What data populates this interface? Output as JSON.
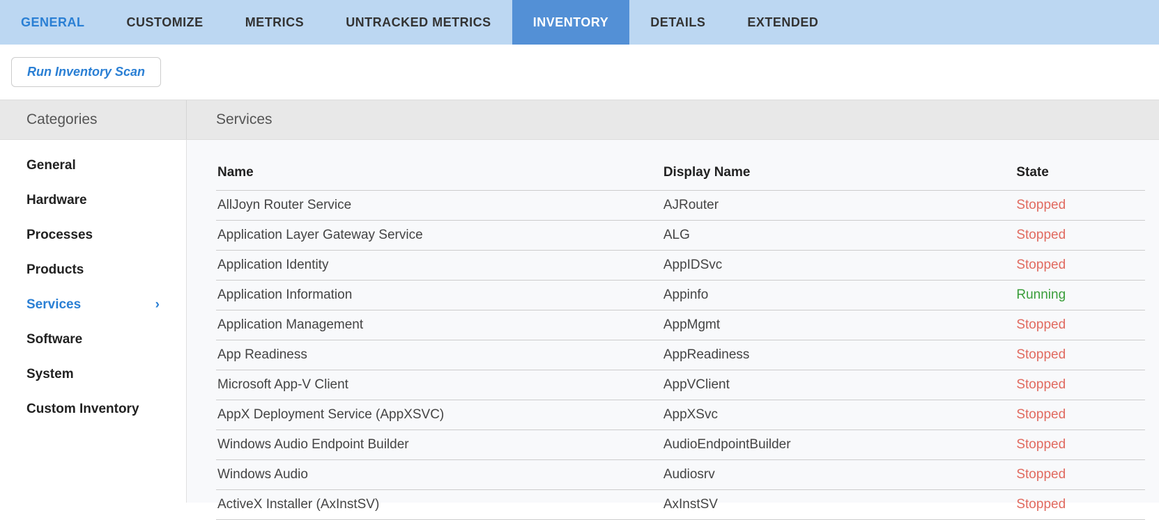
{
  "tabs": [
    {
      "label": "GENERAL",
      "state": "first"
    },
    {
      "label": "CUSTOMIZE",
      "state": ""
    },
    {
      "label": "METRICS",
      "state": ""
    },
    {
      "label": "UNTRACKED METRICS",
      "state": ""
    },
    {
      "label": "INVENTORY",
      "state": "active"
    },
    {
      "label": "DETAILS",
      "state": ""
    },
    {
      "label": "EXTENDED",
      "state": ""
    }
  ],
  "actions": {
    "run_scan_label": "Run Inventory Scan"
  },
  "headers": {
    "categories": "Categories",
    "panel_title": "Services"
  },
  "sidebar": {
    "items": [
      {
        "label": "General",
        "active": false
      },
      {
        "label": "Hardware",
        "active": false
      },
      {
        "label": "Processes",
        "active": false
      },
      {
        "label": "Products",
        "active": false
      },
      {
        "label": "Services",
        "active": true
      },
      {
        "label": "Software",
        "active": false
      },
      {
        "label": "System",
        "active": false
      },
      {
        "label": "Custom Inventory",
        "active": false
      }
    ]
  },
  "table": {
    "columns": {
      "name": "Name",
      "display": "Display Name",
      "state": "State"
    },
    "rows": [
      {
        "name": "AllJoyn Router Service",
        "display": "AJRouter",
        "state": "Stopped"
      },
      {
        "name": "Application Layer Gateway Service",
        "display": "ALG",
        "state": "Stopped"
      },
      {
        "name": "Application Identity",
        "display": "AppIDSvc",
        "state": "Stopped"
      },
      {
        "name": "Application Information",
        "display": "Appinfo",
        "state": "Running"
      },
      {
        "name": "Application Management",
        "display": "AppMgmt",
        "state": "Stopped"
      },
      {
        "name": "App Readiness",
        "display": "AppReadiness",
        "state": "Stopped"
      },
      {
        "name": "Microsoft App-V Client",
        "display": "AppVClient",
        "state": "Stopped"
      },
      {
        "name": "AppX Deployment Service (AppXSVC)",
        "display": "AppXSvc",
        "state": "Stopped"
      },
      {
        "name": "Windows Audio Endpoint Builder",
        "display": "AudioEndpointBuilder",
        "state": "Stopped"
      },
      {
        "name": "Windows Audio",
        "display": "Audiosrv",
        "state": "Stopped"
      },
      {
        "name": "ActiveX Installer (AxInstSV)",
        "display": "AxInstSV",
        "state": "Stopped"
      }
    ]
  }
}
